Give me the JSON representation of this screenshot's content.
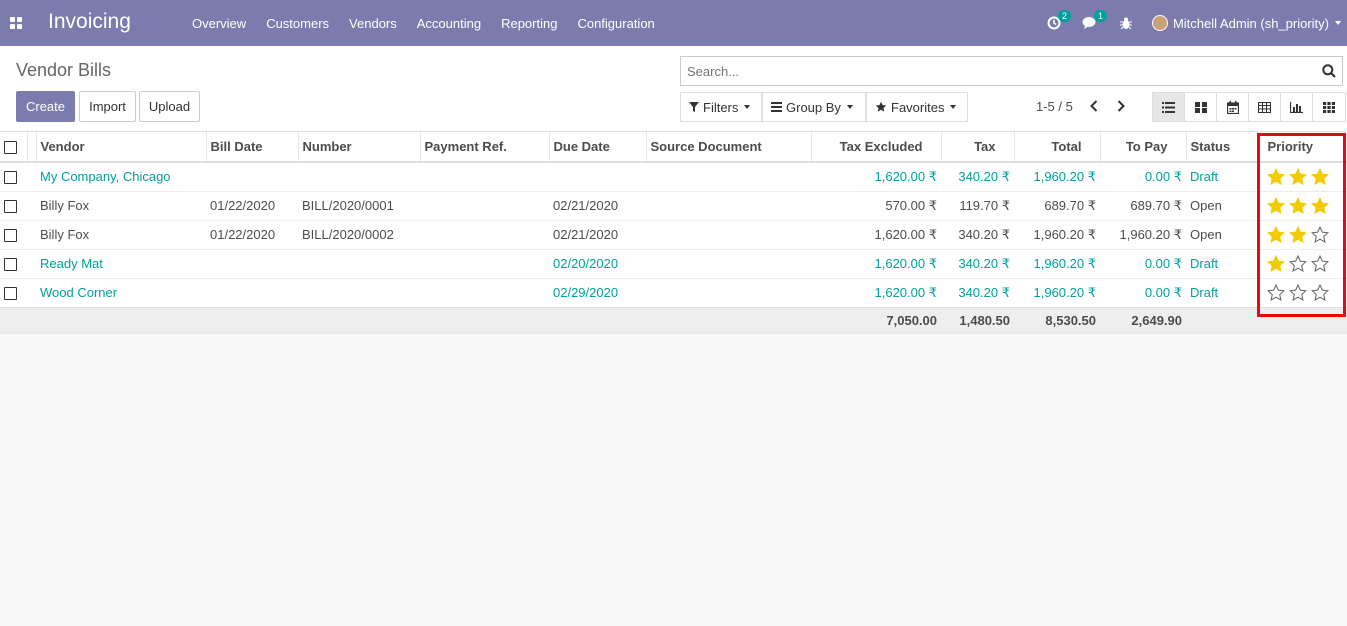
{
  "navbar": {
    "brand": "Invoicing",
    "menu": [
      "Overview",
      "Customers",
      "Vendors",
      "Accounting",
      "Reporting",
      "Configuration"
    ],
    "activity_badge": "2",
    "messages_badge": "1",
    "user": "Mitchell Admin (sh_priority)"
  },
  "control": {
    "title": "Vendor Bills",
    "create": "Create",
    "import": "Import",
    "upload": "Upload",
    "search_placeholder": "Search...",
    "filters": "Filters",
    "group_by": "Group By",
    "favorites": "Favorites",
    "pager": "1-5 / 5"
  },
  "table": {
    "headers": {
      "vendor": "Vendor",
      "bill_date": "Bill Date",
      "number": "Number",
      "payment_ref": "Payment Ref.",
      "due_date": "Due Date",
      "source": "Source Document",
      "tax_excluded": "Tax Excluded",
      "tax": "Tax",
      "total": "Total",
      "to_pay": "To Pay",
      "status": "Status",
      "priority": "Priority"
    },
    "rows": [
      {
        "vendor": "My Company, Chicago",
        "bill_date": "",
        "number": "",
        "payment_ref": "",
        "due_date": "",
        "source": "",
        "tax_excluded": "1,620.00 ₹",
        "tax": "340.20 ₹",
        "total": "1,960.20 ₹",
        "to_pay": "0.00 ₹",
        "status": "Draft",
        "priority": 3,
        "draft": true
      },
      {
        "vendor": "Billy Fox",
        "bill_date": "01/22/2020",
        "number": "BILL/2020/0001",
        "payment_ref": "",
        "due_date": "02/21/2020",
        "source": "",
        "tax_excluded": "570.00 ₹",
        "tax": "119.70 ₹",
        "total": "689.70 ₹",
        "to_pay": "689.70 ₹",
        "status": "Open",
        "priority": 3,
        "draft": false
      },
      {
        "vendor": "Billy Fox",
        "bill_date": "01/22/2020",
        "number": "BILL/2020/0002",
        "payment_ref": "",
        "due_date": "02/21/2020",
        "source": "",
        "tax_excluded": "1,620.00 ₹",
        "tax": "340.20 ₹",
        "total": "1,960.20 ₹",
        "to_pay": "1,960.20 ₹",
        "status": "Open",
        "priority": 2,
        "draft": false
      },
      {
        "vendor": "Ready Mat",
        "bill_date": "",
        "number": "",
        "payment_ref": "",
        "due_date": "02/20/2020",
        "source": "",
        "tax_excluded": "1,620.00 ₹",
        "tax": "340.20 ₹",
        "total": "1,960.20 ₹",
        "to_pay": "0.00 ₹",
        "status": "Draft",
        "priority": 1,
        "draft": true
      },
      {
        "vendor": "Wood Corner",
        "bill_date": "",
        "number": "",
        "payment_ref": "",
        "due_date": "02/29/2020",
        "source": "",
        "tax_excluded": "1,620.00 ₹",
        "tax": "340.20 ₹",
        "total": "1,960.20 ₹",
        "to_pay": "0.00 ₹",
        "status": "Draft",
        "priority": 0,
        "draft": true
      }
    ],
    "totals": {
      "tax_excluded": "7,050.00",
      "tax": "1,480.50",
      "total": "8,530.50",
      "to_pay": "2,649.90"
    }
  },
  "colors": {
    "brand": "#7c7bad",
    "draft_link": "#00a09d",
    "star_filled": "#f3cc00",
    "highlight_border": "#e20c0c"
  }
}
